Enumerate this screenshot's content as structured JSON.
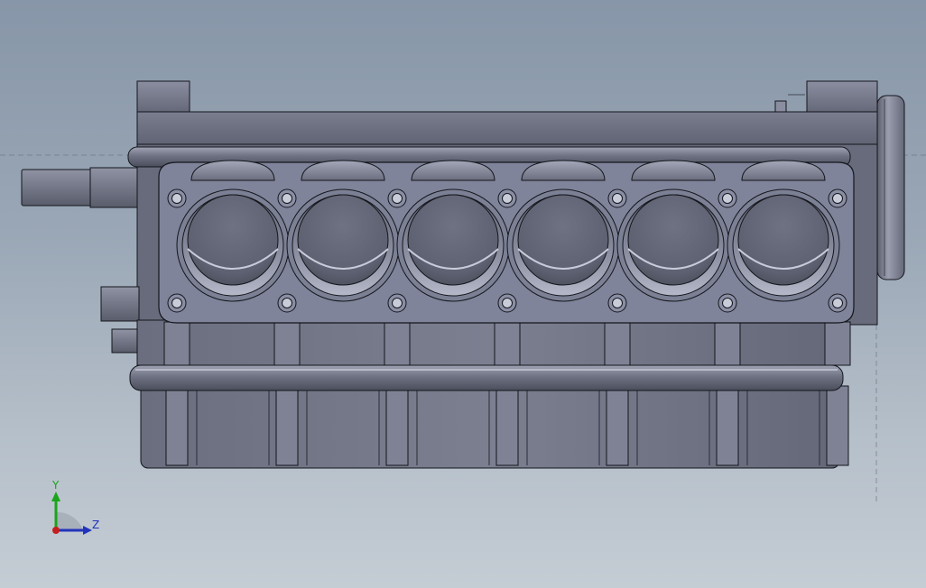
{
  "viewport": {
    "background_top": "#8796a8",
    "background_bottom": "#c4ccd4"
  },
  "model": {
    "cylinder_count": 6,
    "metal_color": "#6b6f7f",
    "edge_color": "#14161c"
  },
  "triad": {
    "y_label": "Y",
    "z_label": "Z",
    "y_color": "#1aa51a",
    "z_color": "#2233bb",
    "origin_color": "#c41e1e"
  }
}
